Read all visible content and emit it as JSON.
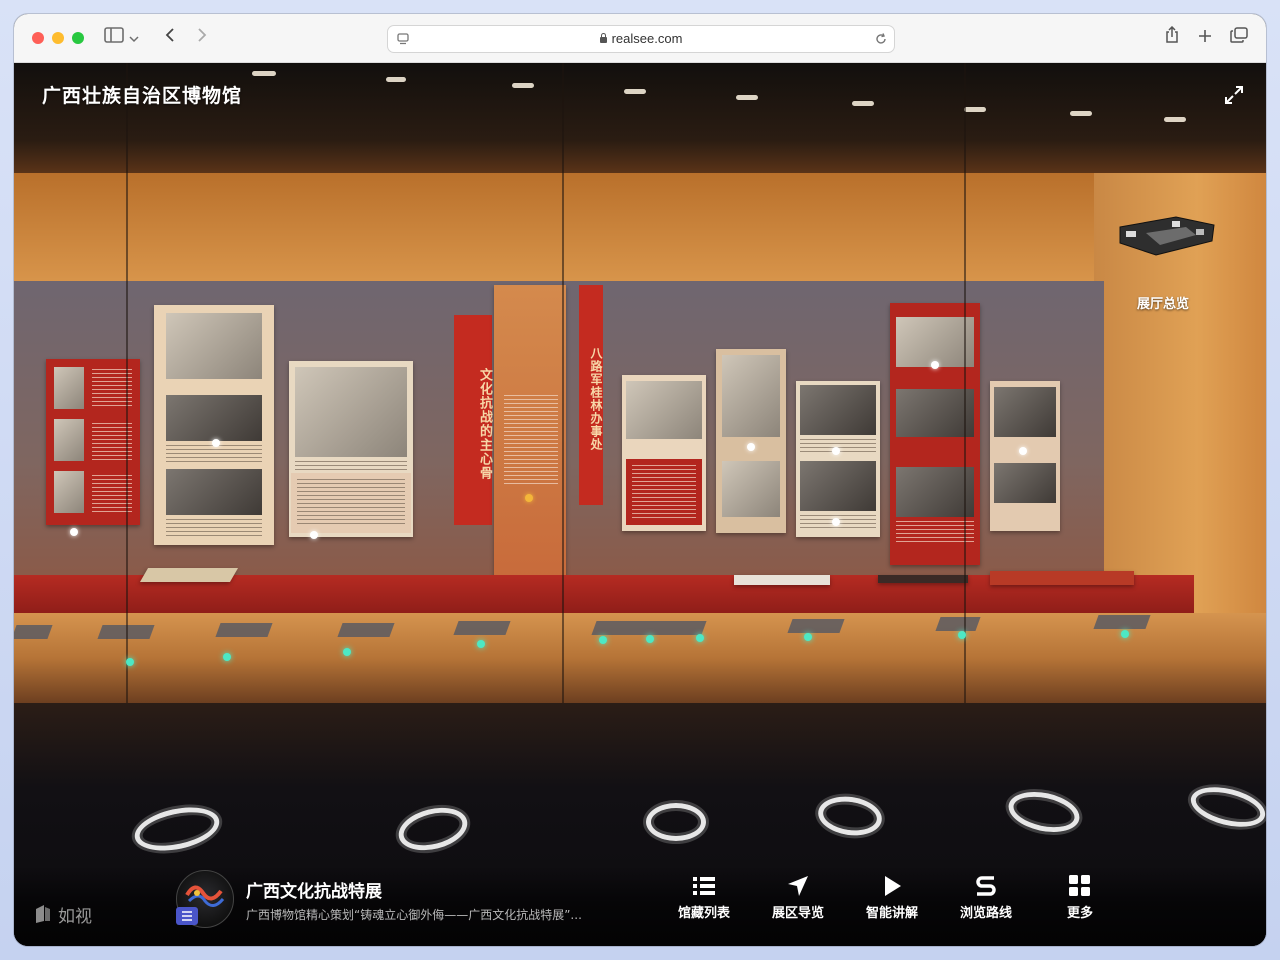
{
  "browser": {
    "address": "realsee.com"
  },
  "viewer": {
    "museum_title": "广西壮族自治区博物馆",
    "overview_label": "展厅总览",
    "banner_left": "文化抗战的主心骨",
    "banner_right": "八路军桂林办事处",
    "brand": "如视"
  },
  "exhibit": {
    "title": "广西文化抗战特展",
    "subtitle": "广西博物馆精心策划“铸魂立心御外侮——广西文化抗战特展”..."
  },
  "nav": [
    {
      "label": "馆藏列表",
      "icon": "list-icon"
    },
    {
      "label": "展区导览",
      "icon": "navigation-arrow-icon"
    },
    {
      "label": "智能讲解",
      "icon": "play-icon"
    },
    {
      "label": "浏览路线",
      "icon": "route-icon"
    },
    {
      "label": "更多",
      "icon": "grid-icon"
    }
  ],
  "colors": {
    "hotspot": "#4de8c4",
    "banner_red": "#c42b20"
  }
}
